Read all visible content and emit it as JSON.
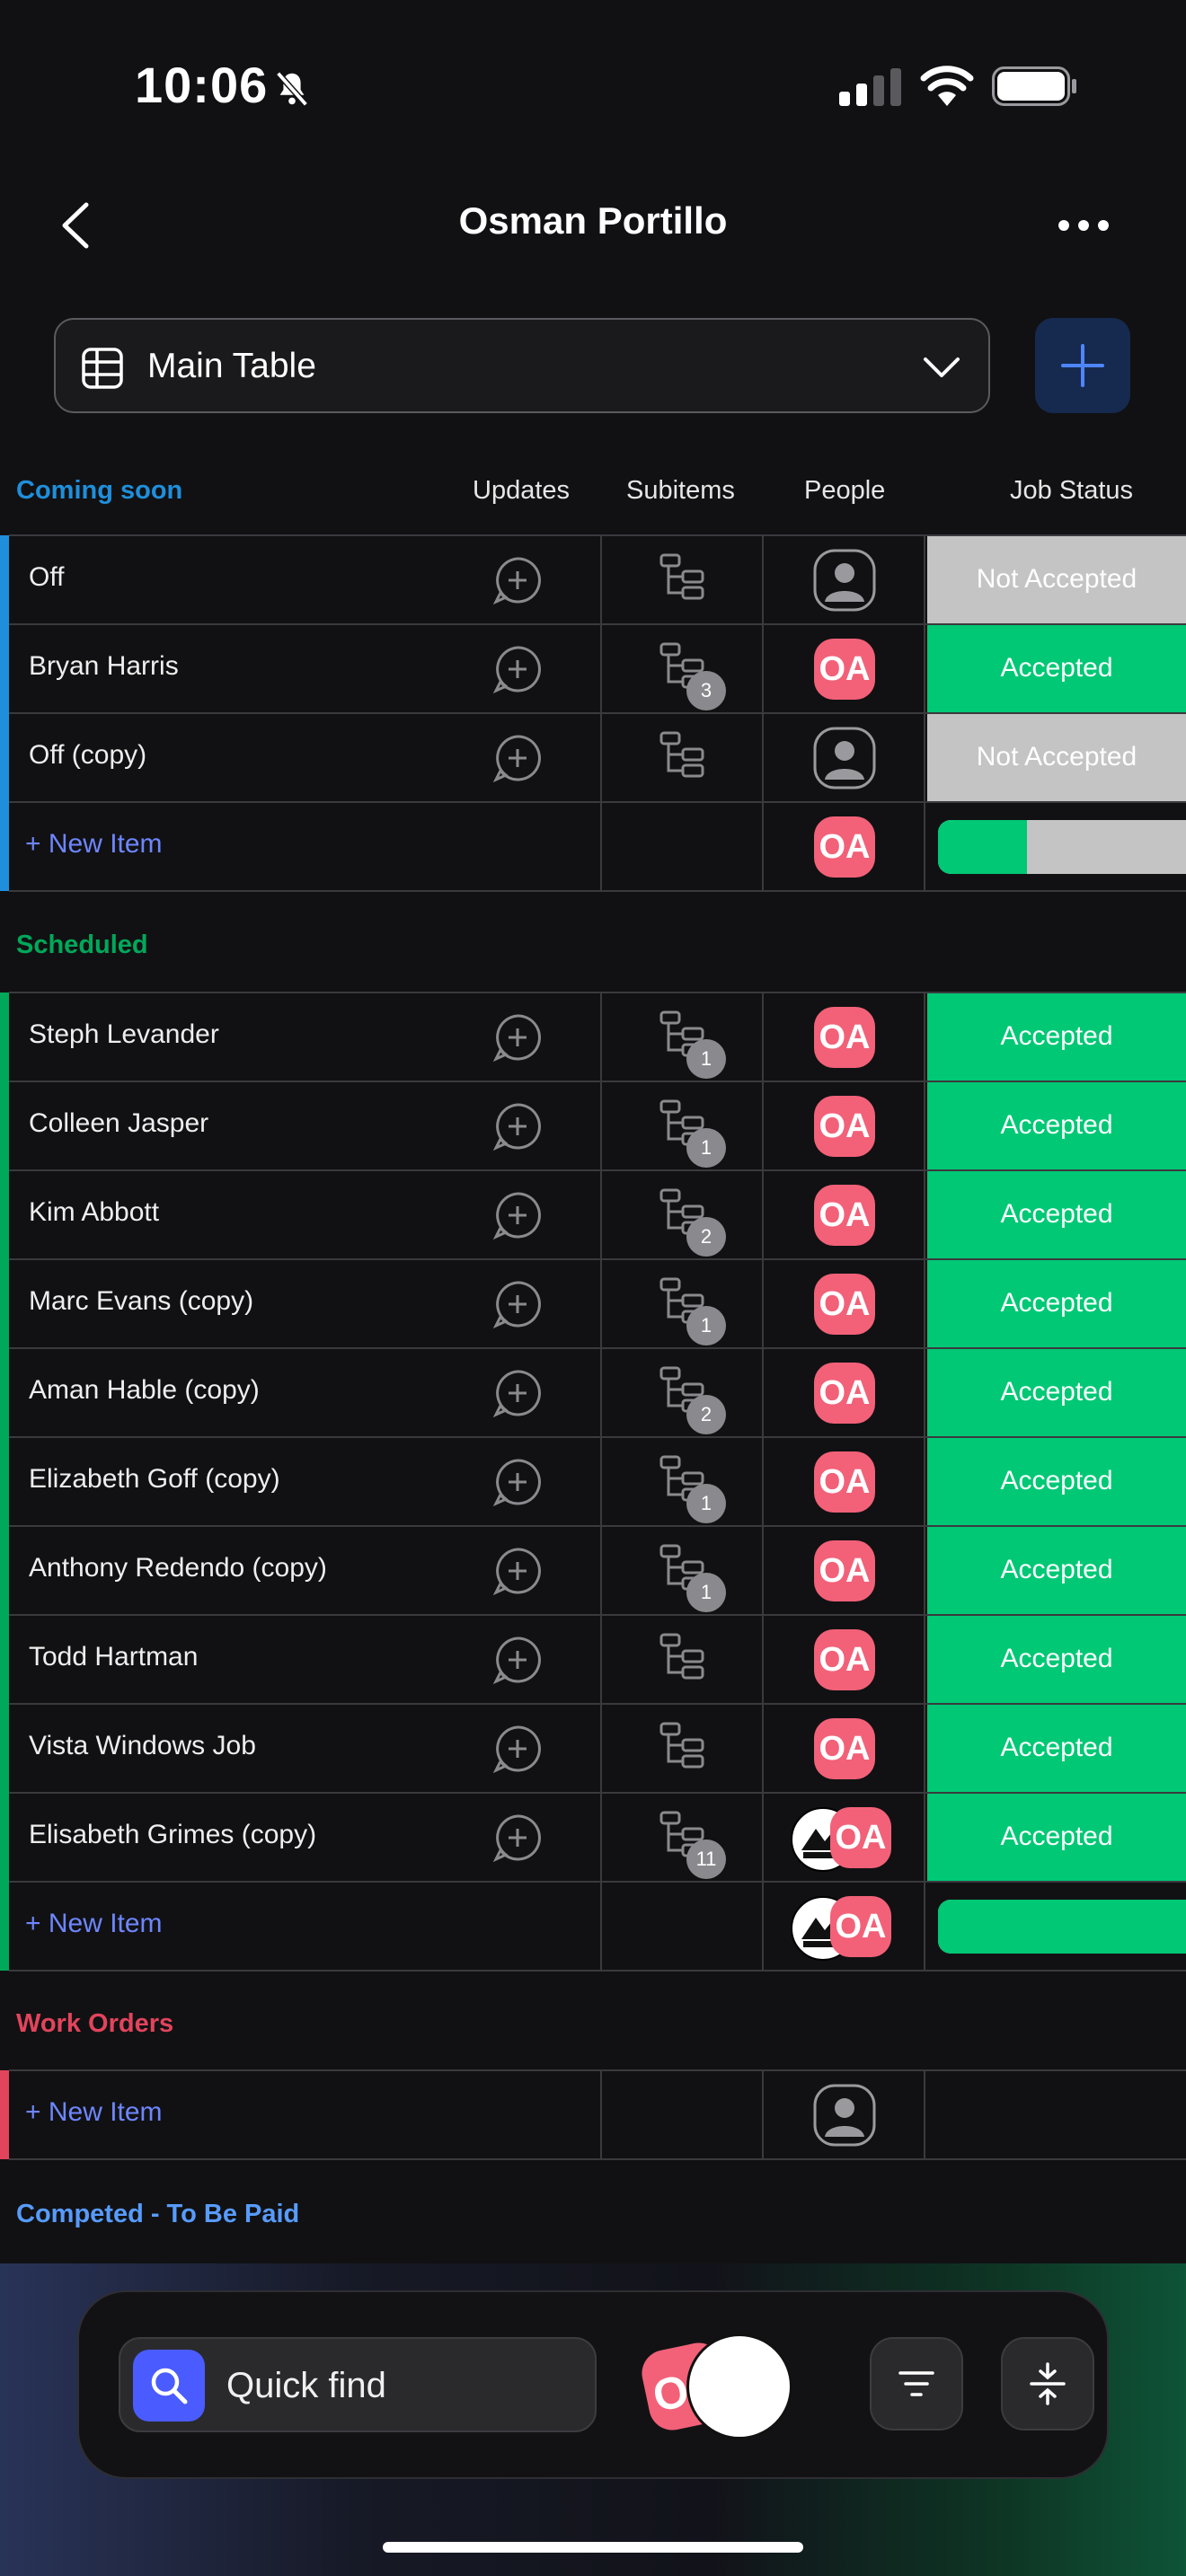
{
  "status_bar": {
    "time": "10:06"
  },
  "header": {
    "title": "Osman Portillo"
  },
  "table_selector": {
    "label": "Main Table"
  },
  "columns": {
    "updates": "Updates",
    "subitems": "Subitems",
    "people": "People",
    "job_status": "Job Status"
  },
  "avatar_initials": "OA",
  "new_item_label": "+ New Item",
  "groups": {
    "coming_soon": {
      "title": "Coming soon",
      "color": "#1f8fdb",
      "rows": [
        {
          "name": "Off",
          "subitems": "",
          "status": "Not Accepted"
        },
        {
          "name": "Bryan Harris",
          "subitems": "3",
          "status": "Accepted"
        },
        {
          "name": "Off (copy)",
          "subitems": "",
          "status": "Not Accepted"
        }
      ],
      "summary_accepted_fraction": 0.33
    },
    "scheduled": {
      "title": "Scheduled",
      "color": "#00a85a",
      "rows": [
        {
          "name": "Steph Levander",
          "subitems": "1",
          "status": "Accepted"
        },
        {
          "name": "Colleen Jasper",
          "subitems": "1",
          "status": "Accepted"
        },
        {
          "name": "Kim Abbott",
          "subitems": "2",
          "status": "Accepted"
        },
        {
          "name": "Marc Evans (copy)",
          "subitems": "1",
          "status": "Accepted"
        },
        {
          "name": "Aman Hable (copy)",
          "subitems": "2",
          "status": "Accepted"
        },
        {
          "name": "Elizabeth Goff (copy)",
          "subitems": "1",
          "status": "Accepted"
        },
        {
          "name": "Anthony Redendo (copy)",
          "subitems": "1",
          "status": "Accepted"
        },
        {
          "name": "Todd Hartman",
          "subitems": "",
          "status": "Accepted"
        },
        {
          "name": "Vista Windows Job",
          "subitems": "",
          "status": "Accepted"
        },
        {
          "name": "Elisabeth Grimes (copy)",
          "subitems": "11",
          "status": "Accepted"
        }
      ],
      "summary_accepted_fraction": 1.0
    },
    "work_orders": {
      "title": "Work Orders",
      "color": "#e2445c"
    },
    "completed": {
      "title": "Competed - To Be Paid",
      "color": "#579bfc"
    }
  },
  "toolbar": {
    "search_label": "Quick find",
    "avatar_letter": "O"
  },
  "colors": {
    "accepted": "#00c875",
    "not_accepted": "#c4c4c4",
    "avatar": "#f26178",
    "accent": "#4a5cff"
  }
}
